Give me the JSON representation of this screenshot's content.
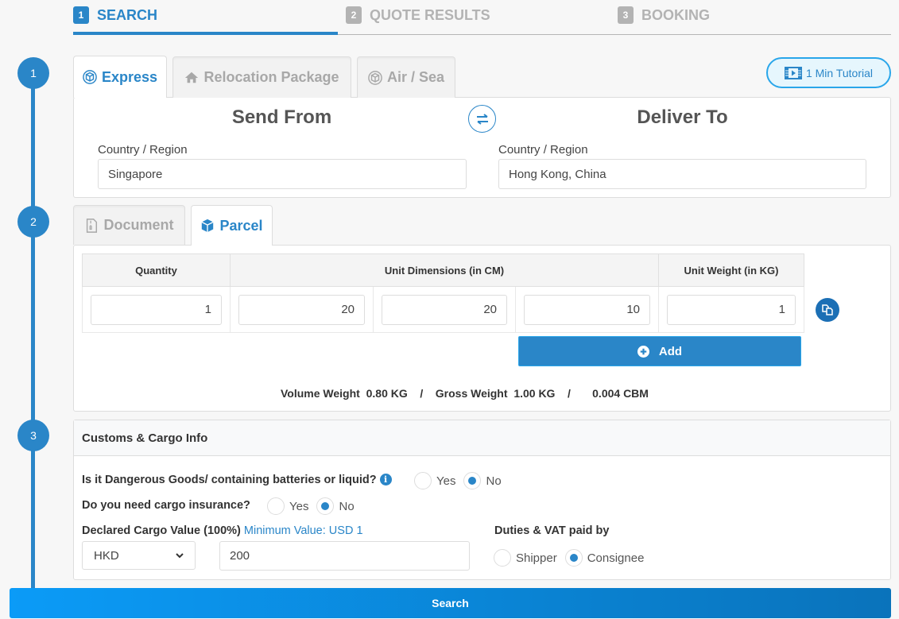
{
  "steps": [
    {
      "num": "1",
      "label": "SEARCH",
      "state": "active"
    },
    {
      "num": "2",
      "label": "QUOTE RESULTS",
      "state": "inactive"
    },
    {
      "num": "3",
      "label": "BOOKING",
      "state": "inactive"
    }
  ],
  "timeline": [
    "1",
    "2",
    "3"
  ],
  "service_tabs": [
    {
      "label": "Express",
      "icon": "box-icon",
      "active": true
    },
    {
      "label": "Relocation Package",
      "icon": "home-icon",
      "active": false
    },
    {
      "label": "Air / Sea",
      "icon": "box-icon",
      "active": false
    }
  ],
  "tutorial_label": "1 Min Tutorial",
  "route": {
    "from_title": "Send From",
    "to_title": "Deliver To",
    "from_label": "Country / Region",
    "to_label": "Country / Region",
    "from_value": "Singapore",
    "to_value": "Hong Kong, China"
  },
  "shipment_tabs": [
    {
      "label": "Document",
      "icon": "document-icon",
      "active": false
    },
    {
      "label": "Parcel",
      "icon": "parcel-icon",
      "active": true
    }
  ],
  "parcel_table": {
    "headers": [
      "Quantity",
      "Unit Dimensions (in CM)",
      "Unit Weight (in KG)"
    ],
    "row": {
      "quantity": "1",
      "length": "20",
      "width": "20",
      "height": "10",
      "weight": "1"
    }
  },
  "add_label": "Add",
  "summary": {
    "volume_label": "Volume Weight",
    "volume_value": "0.80 KG",
    "sep": "/",
    "gross_label": "Gross Weight",
    "gross_value": "1.00 KG",
    "cbm_value": "0.004 CBM"
  },
  "customs": {
    "title": "Customs & Cargo Info",
    "dangerous_q": "Is it Dangerous Goods/ containing batteries or liquid?",
    "insurance_q": "Do you need cargo insurance?",
    "yes": "Yes",
    "no": "No",
    "declared_label": "Declared Cargo Value (100%)",
    "declared_hint": "Minimum Value: USD 1",
    "currency": "HKD",
    "declared_value": "200",
    "duties_label": "Duties & VAT paid by",
    "shipper": "Shipper",
    "consignee": "Consignee",
    "dangerous_selected": "No",
    "insurance_selected": "No",
    "duties_selected": "Consignee"
  },
  "search_label": "Search",
  "colors": {
    "accent": "#2a86c8",
    "inactive": "#b3b3b3",
    "tutorial_border": "#29a6ea"
  }
}
